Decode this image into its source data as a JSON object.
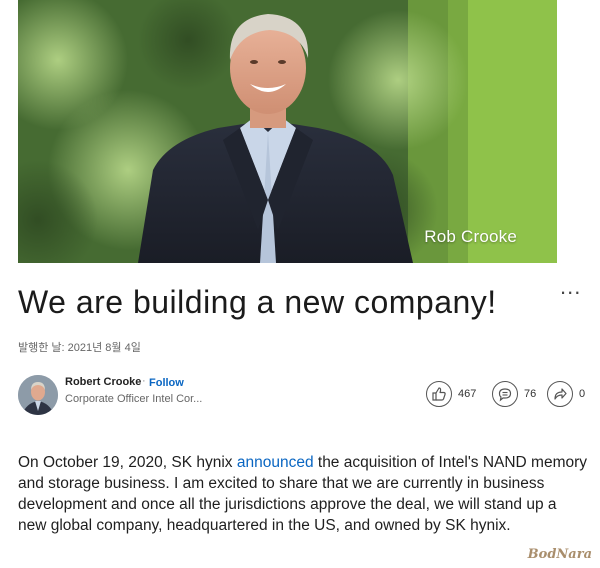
{
  "hero": {
    "caption": "Rob Crooke",
    "caption_color": "#ffffff",
    "accent_green": "#8fc24a"
  },
  "article": {
    "title": "We are building a new company!",
    "published": "발행한 날: 2021년 8월 4일",
    "more_menu_label": "..."
  },
  "author": {
    "name": "Robert Crooke",
    "separator": "·",
    "follow_label": "Follow",
    "headline": "Corporate Officer Intel Cor...",
    "avatar_icon": "person-avatar"
  },
  "stats": {
    "likes": "467",
    "comments": "76",
    "shares": "0",
    "like_icon": "thumbs-up-icon",
    "comment_icon": "comment-icon",
    "share_icon": "share-arrow-icon"
  },
  "body": {
    "intro": "On October 19, 2020, SK hynix ",
    "link_text": "announced",
    "rest": " the acquisition of Intel's NAND memory and storage business. I am excited to share that we are currently in business development and once all the jurisdictions approve the deal, we will stand up a new global company, headquartered in the US, and owned by SK hynix."
  },
  "watermark": {
    "text": "BodNara"
  },
  "colors": {
    "link_blue": "#0a66c2",
    "text_dark": "#1d1d1d",
    "muted": "#666666"
  }
}
